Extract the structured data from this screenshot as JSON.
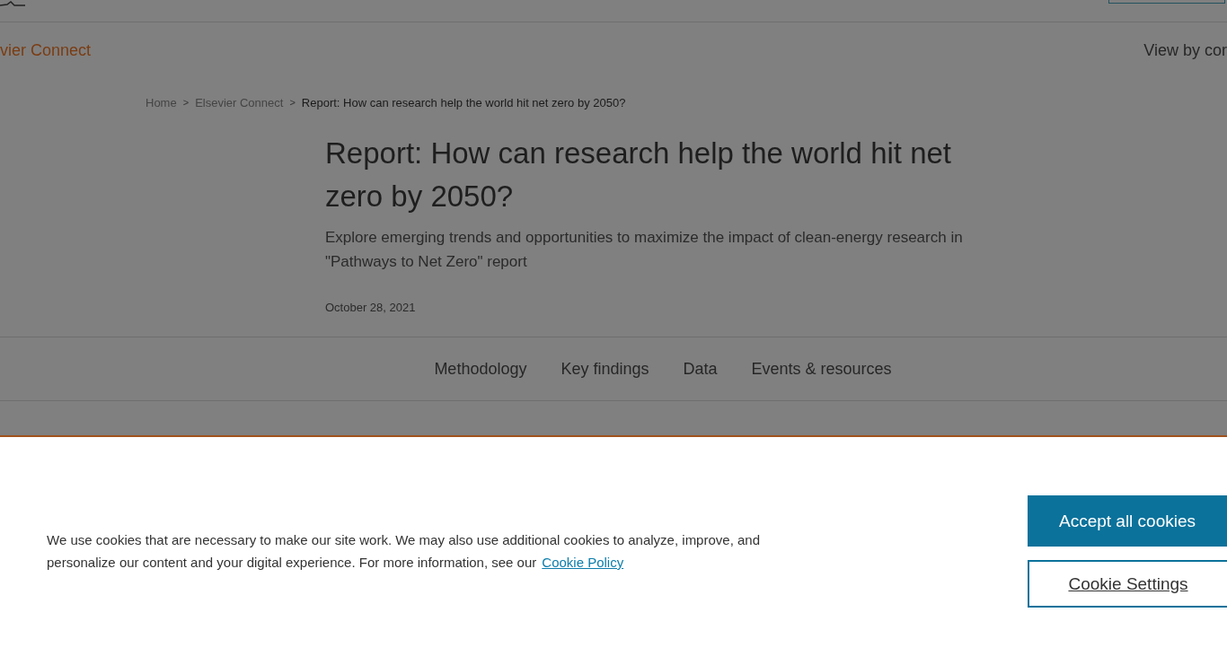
{
  "nav": {
    "site_name": "vier Connect",
    "view_by": "View by cor"
  },
  "breadcrumbs": [
    {
      "label": "Home",
      "current": false
    },
    {
      "label": "Elsevier Connect",
      "current": false
    },
    {
      "label": "Report: How can research help the world hit net zero by 2050?",
      "current": true
    }
  ],
  "breadcrumb_separator": ">",
  "article": {
    "title": "Report: How can research help the world hit net zero by 2050?",
    "subtitle": "Explore emerging trends and opportunities to maximize the impact of clean-energy research in \"Pathways to Net Zero\" report",
    "date": "October 28, 2021"
  },
  "section_tabs": [
    "Methodology",
    "Key findings",
    "Data",
    "Events & resources"
  ],
  "cookie_banner": {
    "text": "We use cookies that are necessary to make our site work. We may also use additional cookies to analyze, improve, and personalize our content and your digital experience. For more information, see our",
    "link": "Cookie Policy",
    "buttons": [
      {
        "label": "Accept all cookies",
        "kind": "primary"
      },
      {
        "label": "Cookie Settings",
        "kind": "secondary"
      }
    ]
  }
}
